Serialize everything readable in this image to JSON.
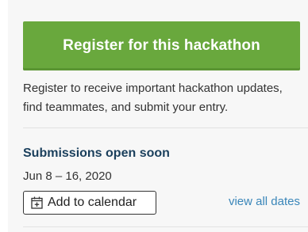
{
  "register": {
    "button_label": "Register for this hackathon",
    "description": "Register to receive important hackathon updates, find teammates, and submit your entry."
  },
  "submissions": {
    "title": "Submissions open soon",
    "dates": "Jun 8 – 16, 2020",
    "calendar_button_label": "Add to calendar",
    "calendar_icon": "calendar-plus-icon",
    "view_all_label": "view all dates"
  },
  "colors": {
    "primary_green": "#69a83d",
    "heading_navy": "#1a3f5c",
    "link_blue": "#3a86b9",
    "panel_bg": "#f7f7f7"
  }
}
